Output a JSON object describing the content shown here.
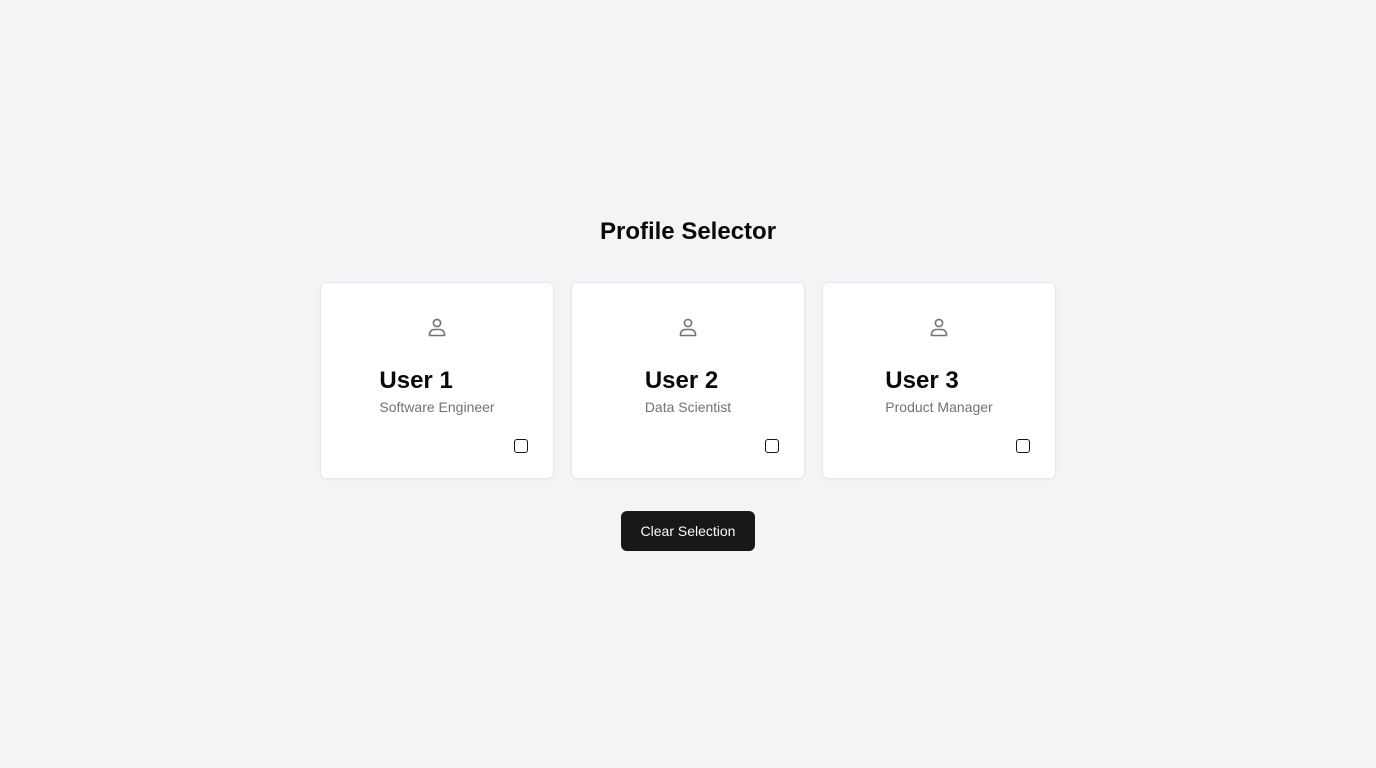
{
  "page": {
    "title": "Profile Selector"
  },
  "profiles": [
    {
      "name": "User 1",
      "role": "Software Engineer",
      "icon": "user-icon",
      "selected": false
    },
    {
      "name": "User 2",
      "role": "Data Scientist",
      "icon": "user-icon",
      "selected": false
    },
    {
      "name": "User 3",
      "role": "Product Manager",
      "icon": "user-icon",
      "selected": false
    }
  ],
  "actions": {
    "clear_label": "Clear Selection"
  },
  "colors": {
    "background": "#f3f4f6",
    "card": "#ffffff",
    "primary_button": "#18181b",
    "muted_text": "#737373"
  }
}
